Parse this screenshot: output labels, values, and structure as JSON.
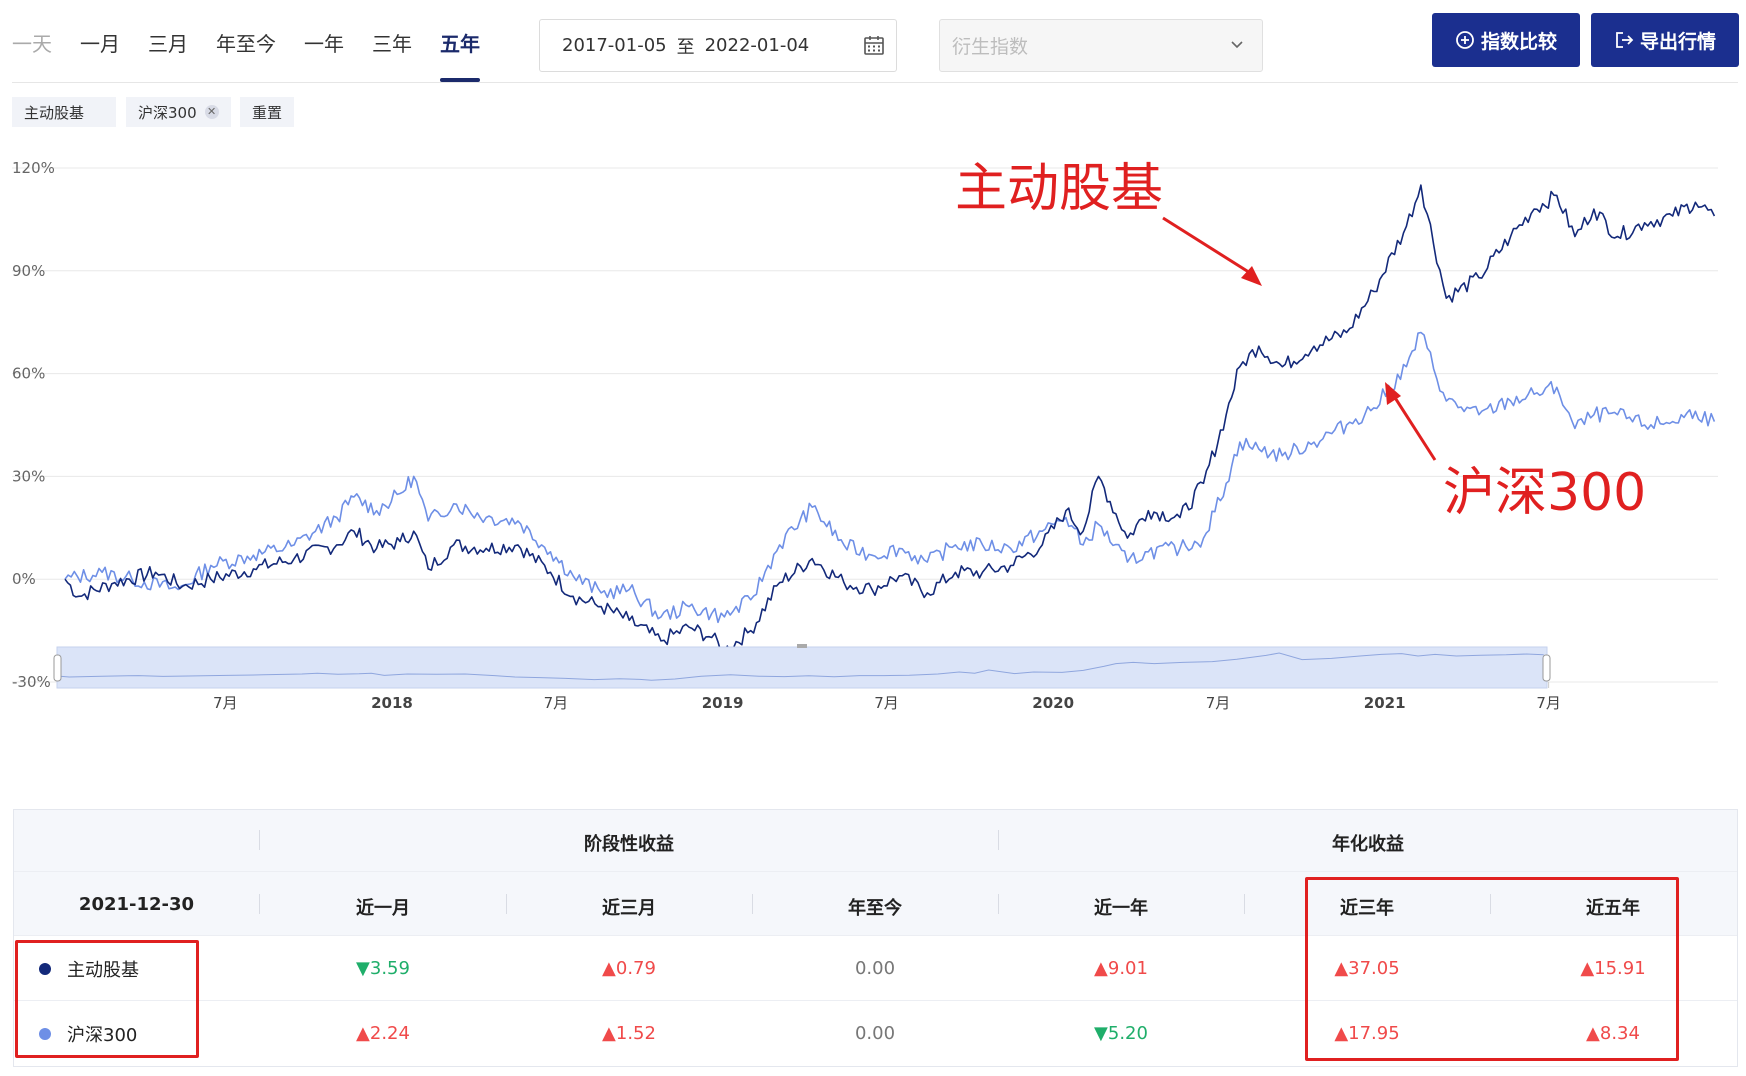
{
  "tabs": [
    "一天",
    "一月",
    "三月",
    "年至今",
    "一年",
    "三年",
    "五年"
  ],
  "active_tab": "五年",
  "date_range": {
    "start": "2017-01-05",
    "sep": "至",
    "end": "2022-01-04"
  },
  "derived_placeholder": "衍生指数",
  "buttons": {
    "compare": "指数比较",
    "export": "导出行情"
  },
  "chips": [
    {
      "label": "主动股基",
      "closable": false
    },
    {
      "label": "沪深300",
      "closable": true
    },
    {
      "label": "重置",
      "closable": false
    }
  ],
  "colors": {
    "primary": "#1b2f8f",
    "series1": "#13297a",
    "series2": "#6e8fe6",
    "up": "#f04a4a",
    "down": "#1fae6a",
    "annotation": "#e02020"
  },
  "chart_data": {
    "type": "line",
    "y_ticks": [
      "120%",
      "90%",
      "60%",
      "30%",
      "0%",
      "-30%"
    ],
    "ylim": [
      -30,
      120
    ],
    "x_ticks": [
      {
        "label": "7月",
        "date": "2017-07-01",
        "bold": false
      },
      {
        "label": "2018",
        "date": "2018-01-01",
        "bold": true
      },
      {
        "label": "7月",
        "date": "2018-07-01",
        "bold": false
      },
      {
        "label": "2019",
        "date": "2019-01-01",
        "bold": true
      },
      {
        "label": "7月",
        "date": "2019-07-01",
        "bold": false
      },
      {
        "label": "2020",
        "date": "2020-01-01",
        "bold": true
      },
      {
        "label": "7月",
        "date": "2020-07-01",
        "bold": false
      },
      {
        "label": "2021",
        "date": "2021-01-01",
        "bold": true
      },
      {
        "label": "7月",
        "date": "2021-07-01",
        "bold": false
      }
    ],
    "x_range": [
      "2017-01-05",
      "2022-01-04"
    ],
    "series": [
      {
        "name": "主动股基",
        "color": "#13297a",
        "points": [
          [
            "2017-01-05",
            0
          ],
          [
            "2017-01-20",
            -5
          ],
          [
            "2017-03-01",
            -1
          ],
          [
            "2017-04-15",
            2
          ],
          [
            "2017-05-15",
            -2
          ],
          [
            "2017-06-15",
            0
          ],
          [
            "2017-08-01",
            3
          ],
          [
            "2017-09-15",
            6
          ],
          [
            "2017-11-01",
            10
          ],
          [
            "2017-11-20",
            14
          ],
          [
            "2017-12-15",
            9
          ],
          [
            "2018-01-10",
            11
          ],
          [
            "2018-01-25",
            14
          ],
          [
            "2018-02-10",
            3
          ],
          [
            "2018-03-10",
            10
          ],
          [
            "2018-04-15",
            9
          ],
          [
            "2018-05-20",
            10
          ],
          [
            "2018-06-25",
            2
          ],
          [
            "2018-07-20",
            -5
          ],
          [
            "2018-08-20",
            -8
          ],
          [
            "2018-09-20",
            -12
          ],
          [
            "2018-10-25",
            -18
          ],
          [
            "2018-11-25",
            -14
          ],
          [
            "2018-12-20",
            -17
          ],
          [
            "2019-01-03",
            -21
          ],
          [
            "2019-02-01",
            -15
          ],
          [
            "2019-03-05",
            -1
          ],
          [
            "2019-04-10",
            6
          ],
          [
            "2019-05-15",
            -1
          ],
          [
            "2019-06-15",
            -3
          ],
          [
            "2019-07-15",
            1
          ],
          [
            "2019-08-15",
            -4
          ],
          [
            "2019-09-15",
            2
          ],
          [
            "2019-10-15",
            2
          ],
          [
            "2019-11-15",
            4
          ],
          [
            "2019-12-20",
            10
          ],
          [
            "2020-01-15",
            20
          ],
          [
            "2020-02-03",
            14
          ],
          [
            "2020-02-20",
            30
          ],
          [
            "2020-03-23",
            12
          ],
          [
            "2020-04-15",
            20
          ],
          [
            "2020-05-20",
            18
          ],
          [
            "2020-06-15",
            28
          ],
          [
            "2020-07-10",
            48
          ],
          [
            "2020-07-25",
            62
          ],
          [
            "2020-08-15",
            68
          ],
          [
            "2020-09-10",
            62
          ],
          [
            "2020-10-15",
            68
          ],
          [
            "2020-11-20",
            72
          ],
          [
            "2020-12-20",
            84
          ],
          [
            "2021-01-25",
            103
          ],
          [
            "2021-02-10",
            115
          ],
          [
            "2021-03-10",
            82
          ],
          [
            "2021-04-15",
            88
          ],
          [
            "2021-05-20",
            100
          ],
          [
            "2021-06-15",
            108
          ],
          [
            "2021-07-10",
            112
          ],
          [
            "2021-07-30",
            100
          ],
          [
            "2021-08-20",
            108
          ],
          [
            "2021-09-15",
            100
          ],
          [
            "2021-10-15",
            104
          ],
          [
            "2021-11-15",
            106
          ],
          [
            "2021-12-10",
            110
          ],
          [
            "2021-12-31",
            106
          ]
        ]
      },
      {
        "name": "沪深300",
        "color": "#6e8fe6",
        "points": [
          [
            "2017-01-05",
            0
          ],
          [
            "2017-02-15",
            2
          ],
          [
            "2017-03-20",
            0
          ],
          [
            "2017-05-10",
            -3
          ],
          [
            "2017-06-15",
            4
          ],
          [
            "2017-08-01",
            7
          ],
          [
            "2017-09-15",
            10
          ],
          [
            "2017-11-01",
            18
          ],
          [
            "2017-11-20",
            24
          ],
          [
            "2017-12-15",
            20
          ],
          [
            "2018-01-10",
            25
          ],
          [
            "2018-01-25",
            30
          ],
          [
            "2018-02-10",
            17
          ],
          [
            "2018-03-10",
            22
          ],
          [
            "2018-04-15",
            18
          ],
          [
            "2018-05-20",
            17
          ],
          [
            "2018-06-25",
            8
          ],
          [
            "2018-07-20",
            1
          ],
          [
            "2018-08-20",
            -4
          ],
          [
            "2018-09-20",
            -3
          ],
          [
            "2018-10-25",
            -11
          ],
          [
            "2018-11-25",
            -8
          ],
          [
            "2018-12-20",
            -10
          ],
          [
            "2019-01-03",
            -11
          ],
          [
            "2019-02-01",
            -6
          ],
          [
            "2019-03-05",
            10
          ],
          [
            "2019-04-10",
            21
          ],
          [
            "2019-05-15",
            10
          ],
          [
            "2019-06-15",
            7
          ],
          [
            "2019-07-15",
            9
          ],
          [
            "2019-08-15",
            5
          ],
          [
            "2019-09-15",
            10
          ],
          [
            "2019-10-15",
            10
          ],
          [
            "2019-11-15",
            9
          ],
          [
            "2019-12-20",
            14
          ],
          [
            "2020-01-15",
            18
          ],
          [
            "2020-02-03",
            10
          ],
          [
            "2020-02-20",
            16
          ],
          [
            "2020-03-23",
            5
          ],
          [
            "2020-04-15",
            8
          ],
          [
            "2020-05-20",
            9
          ],
          [
            "2020-06-15",
            12
          ],
          [
            "2020-07-10",
            28
          ],
          [
            "2020-07-25",
            40
          ],
          [
            "2020-08-15",
            38
          ],
          [
            "2020-09-10",
            36
          ],
          [
            "2020-10-15",
            40
          ],
          [
            "2020-11-20",
            45
          ],
          [
            "2020-12-20",
            50
          ],
          [
            "2021-01-25",
            62
          ],
          [
            "2021-02-10",
            72
          ],
          [
            "2021-03-10",
            52
          ],
          [
            "2021-04-15",
            48
          ],
          [
            "2021-05-20",
            52
          ],
          [
            "2021-06-15",
            54
          ],
          [
            "2021-07-10",
            56
          ],
          [
            "2021-07-30",
            44
          ],
          [
            "2021-08-20",
            48
          ],
          [
            "2021-09-15",
            48
          ],
          [
            "2021-10-15",
            45
          ],
          [
            "2021-11-15",
            46
          ],
          [
            "2021-12-10",
            49
          ],
          [
            "2021-12-31",
            46
          ]
        ]
      }
    ],
    "annotations": [
      {
        "text": "主动股基",
        "series": "主动股基"
      },
      {
        "text": "沪深300",
        "series": "沪深300"
      }
    ]
  },
  "table": {
    "group_headers": {
      "periodic": "阶段性收益",
      "annualized": "年化收益"
    },
    "date_label": "2021-12-30",
    "columns": [
      "近一月",
      "近三月",
      "年至今",
      "近一年",
      "近三年",
      "近五年"
    ],
    "rows": [
      {
        "name": "主动股基",
        "color": "#13297a",
        "values": [
          {
            "text": "▼3.59",
            "dir": "down"
          },
          {
            "text": "▲0.79",
            "dir": "up"
          },
          {
            "text": "0.00",
            "dir": "flat"
          },
          {
            "text": "▲9.01",
            "dir": "up"
          },
          {
            "text": "▲37.05",
            "dir": "up"
          },
          {
            "text": "▲15.91",
            "dir": "up"
          }
        ]
      },
      {
        "name": "沪深300",
        "color": "#6e8fe6",
        "values": [
          {
            "text": "▲2.24",
            "dir": "up"
          },
          {
            "text": "▲1.52",
            "dir": "up"
          },
          {
            "text": "0.00",
            "dir": "flat"
          },
          {
            "text": "▼5.20",
            "dir": "down"
          },
          {
            "text": "▲17.95",
            "dir": "up"
          },
          {
            "text": "▲8.34",
            "dir": "up"
          }
        ]
      }
    ]
  }
}
